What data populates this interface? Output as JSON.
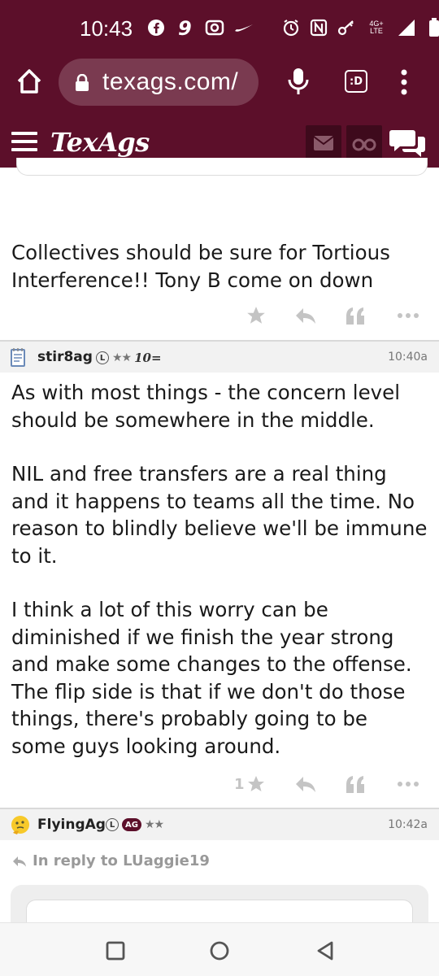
{
  "status_bar": {
    "time": "10:43",
    "network": {
      "top": "4G+",
      "bottom": "LTE"
    }
  },
  "browser": {
    "url": "texags.com/",
    "tab_switcher_label": ":D"
  },
  "site": {
    "logo": "TexAgs"
  },
  "posts": [
    {
      "id": "prev",
      "body": [
        "Collectives should be sure for Tortious Interference!! Tony B come on down"
      ],
      "like_count": ""
    },
    {
      "id": "stir8ag",
      "username": "stir8ag",
      "level_badge": "L",
      "stars": "★★",
      "tenb_badge": "10=",
      "time": "10:40a",
      "body": [
        "As with most things - the concern level should be somewhere in the middle.",
        "NIL and free transfers are a real thing and it happens to teams all the time. No reason to blindly believe we'll be immune to it.",
        "I think a lot of this worry can be diminished if we finish the year strong and make some changes to the offense. The flip side is that if we don't do those things, there's probably going to be some guys looking around."
      ],
      "like_count": "1"
    },
    {
      "id": "flyingag",
      "username": "FlyingAg",
      "level_badge": "L",
      "ag_badge": "AG",
      "stars": "★★",
      "time": "10:42a",
      "reply_to": "In reply to LUaggie19"
    }
  ],
  "colors": {
    "maroon": "#5c0f2a",
    "maroon_dark": "#3e0a1c",
    "action_gray": "#c4c4c4"
  },
  "icons": [
    "facebook-icon",
    "nine-icon",
    "camera-icon",
    "swoosh-icon",
    "alarm-icon",
    "nfc-icon",
    "key-icon",
    "signal-icon",
    "battery-icon",
    "home-icon",
    "lock-icon",
    "mic-icon",
    "overflow-menu-icon",
    "hamburger-icon",
    "mail-icon",
    "binoculars-icon",
    "chat-icon",
    "star-icon",
    "reply-icon",
    "quote-icon",
    "more-icon",
    "back-icon",
    "recents-icon"
  ]
}
